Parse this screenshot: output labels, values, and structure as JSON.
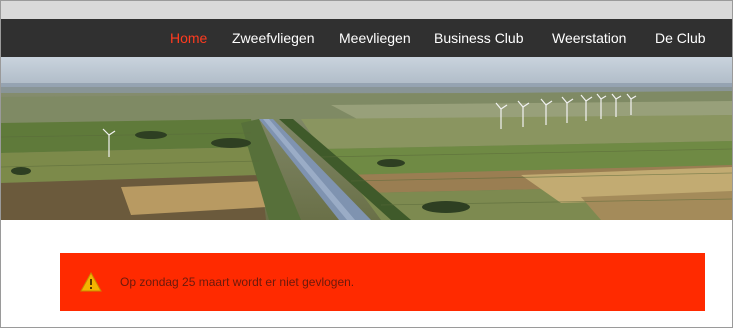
{
  "navigation": {
    "items": [
      {
        "label": "Home",
        "active": true
      },
      {
        "label": "Zweefvliegen",
        "active": false
      },
      {
        "label": "Meevliegen",
        "active": false
      },
      {
        "label": "Business Club",
        "active": false
      },
      {
        "label": "Weerstation",
        "active": false
      },
      {
        "label": "De Club",
        "active": false
      }
    ]
  },
  "banner": {
    "image": "aerial-landscape-canal-windmills"
  },
  "alert": {
    "icon": "warning-icon",
    "message": "Op zondag 25 maart wordt er niet gevlogen."
  },
  "colors": {
    "nav_background": "#303030",
    "nav_active": "#ff3b1f",
    "alert_background": "#ff2a00",
    "alert_text": "#6b1a0c",
    "warning_icon": "#f5b400"
  }
}
